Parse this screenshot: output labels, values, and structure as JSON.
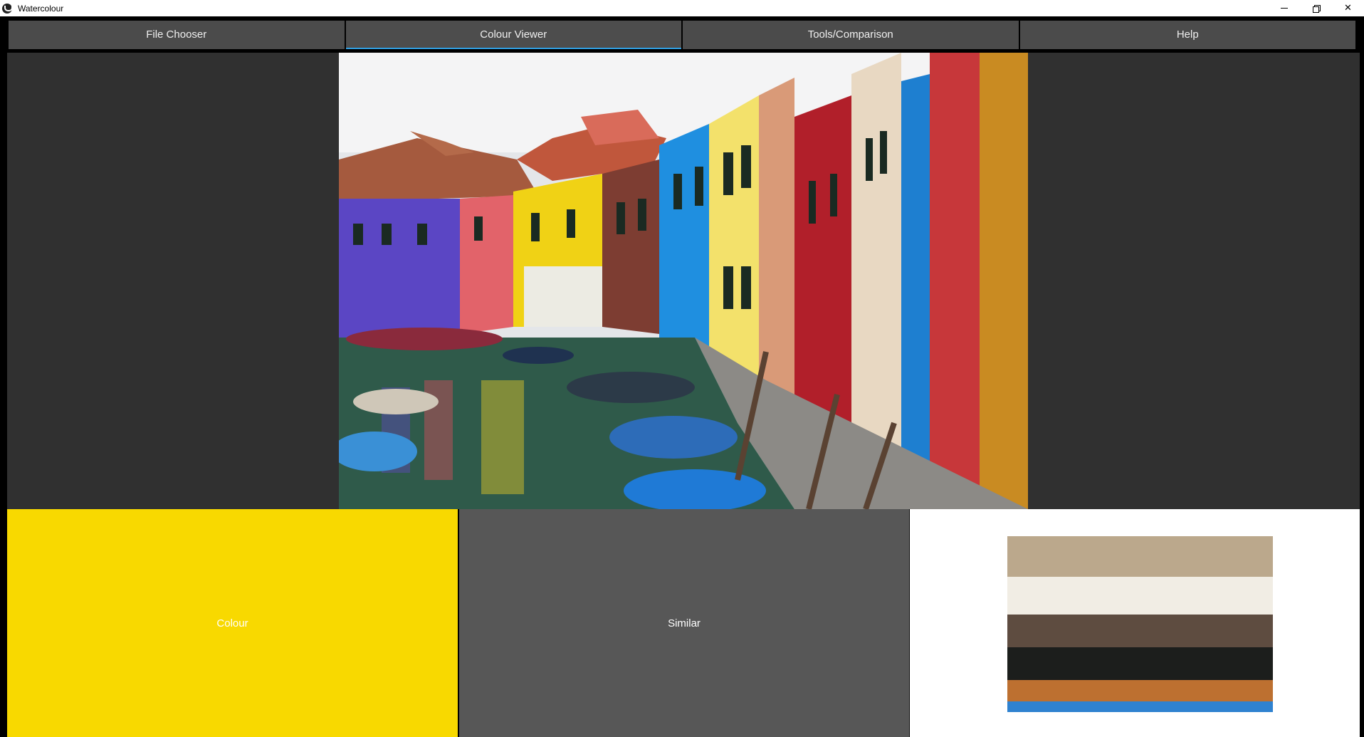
{
  "window": {
    "title": "Watercolour"
  },
  "tabs": [
    {
      "label": "File Chooser",
      "active": false
    },
    {
      "label": "Colour Viewer",
      "active": true
    },
    {
      "label": "Tools/Comparison",
      "active": false
    },
    {
      "label": "Help",
      "active": false
    }
  ],
  "buttons": {
    "colour_label": "Colour",
    "colour_value": "#f8d900",
    "similar_label": "Similar"
  },
  "palette": [
    {
      "color": "#bba88c",
      "weight": 46
    },
    {
      "color": "#f1ede4",
      "weight": 43
    },
    {
      "color": "#5e4c40",
      "weight": 37
    },
    {
      "color": "#1c1e1c",
      "weight": 37
    },
    {
      "color": "#bd7030",
      "weight": 24
    },
    {
      "color": "#2f82d0",
      "weight": 12
    }
  ],
  "accent_color": "#2f9fe3"
}
